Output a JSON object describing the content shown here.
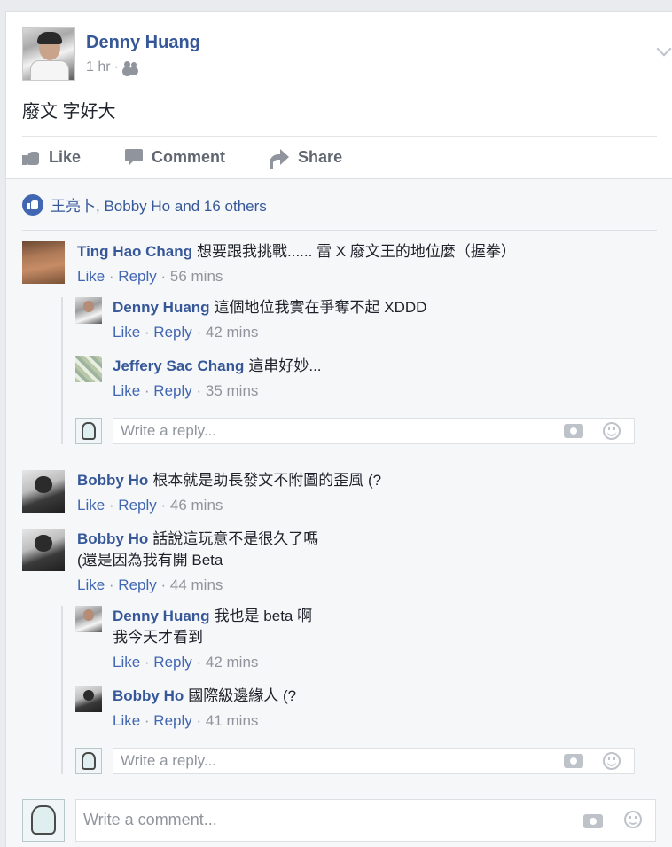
{
  "post": {
    "author": "Denny Huang",
    "time": "1 hr",
    "separator": "·",
    "audience_icon": "friends-icon",
    "text": "廢文 字好大"
  },
  "actions": {
    "like": "Like",
    "comment": "Comment",
    "share": "Share"
  },
  "likes_summary": "王亮卜, Bobby Ho and 16 others",
  "comments": [
    {
      "name": "Ting Hao Chang",
      "text": "想要跟我挑戰...... 雷 X 廢文王的地位麼（握拳）",
      "like": "Like",
      "reply": "Reply",
      "time": "56 mins",
      "replies": [
        {
          "name": "Denny Huang",
          "text": "這個地位我實在爭奪不起 XDDD",
          "like": "Like",
          "reply": "Reply",
          "time": "42 mins"
        },
        {
          "name": "Jeffery Sac Chang",
          "text": "這串好妙...",
          "like": "Like",
          "reply": "Reply",
          "time": "35 mins"
        }
      ],
      "reply_placeholder": "Write a reply..."
    },
    {
      "name": "Bobby Ho",
      "text": "根本就是助長發文不附圖的歪風 (?",
      "like": "Like",
      "reply": "Reply",
      "time": "46 mins"
    },
    {
      "name": "Bobby Ho",
      "text": "話說這玩意不是很久了嗎",
      "text2": "(還是因為我有開 Beta",
      "like": "Like",
      "reply": "Reply",
      "time": "44 mins",
      "replies": [
        {
          "name": "Denny Huang",
          "text": "我也是 beta 啊",
          "text2": "我今天才看到",
          "like": "Like",
          "reply": "Reply",
          "time": "42 mins"
        },
        {
          "name": "Bobby Ho",
          "text": "國際級邊緣人 (?",
          "like": "Like",
          "reply": "Reply",
          "time": "41 mins"
        }
      ],
      "reply_placeholder": "Write a reply..."
    }
  ],
  "comment_placeholder": "Write a comment...",
  "colors": {
    "link": "#365899",
    "meta": "#90949c",
    "accent": "#4267b2",
    "background": "#f6f7f9"
  }
}
